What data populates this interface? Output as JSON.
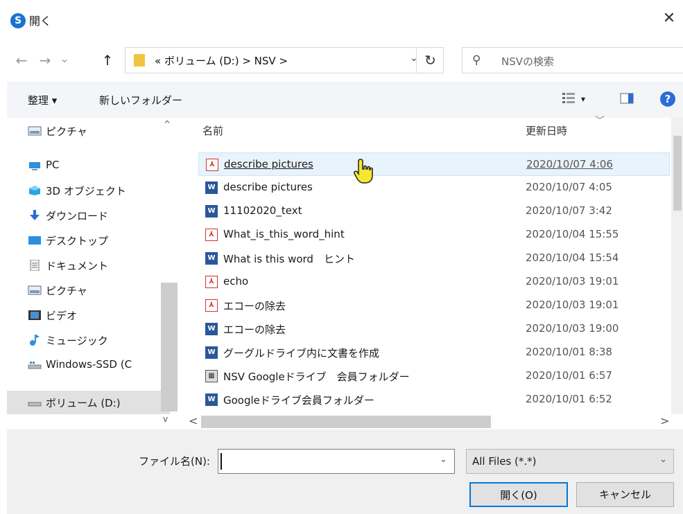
{
  "window": {
    "app_icon": "S",
    "title": "開く",
    "close_glyph": "✕"
  },
  "nav": {
    "back": "←",
    "forward": "→",
    "recent": "⌄",
    "up": "↑",
    "address": "«  ボリューム (D:)  >  NSV  >",
    "address_drop": "⌄",
    "refresh": "↻",
    "search_icon": "⚲",
    "search_placeholder": "NSVの検索"
  },
  "toolbar": {
    "organize": "整理 ▾",
    "new_folder": "新しいフォルダー",
    "view_drop": "▾",
    "help": "?"
  },
  "sidebar": {
    "items": [
      {
        "label": "ピクチャ",
        "icon": "pictures-icon"
      },
      {
        "label": "PC",
        "icon": "pc-icon"
      },
      {
        "label": "3D オブジェクト",
        "icon": "3d-objects-icon"
      },
      {
        "label": "ダウンロード",
        "icon": "downloads-icon"
      },
      {
        "label": "デスクトップ",
        "icon": "desktop-icon"
      },
      {
        "label": "ドキュメント",
        "icon": "documents-icon"
      },
      {
        "label": "ピクチャ",
        "icon": "pictures-icon"
      },
      {
        "label": "ビデオ",
        "icon": "videos-icon"
      },
      {
        "label": "ミュージック",
        "icon": "music-icon"
      },
      {
        "label": "Windows-SSD (C",
        "icon": "drive-icon"
      },
      {
        "label": "ボリューム (D:)",
        "icon": "drive-icon"
      }
    ]
  },
  "list": {
    "col_name": "名前",
    "col_date": "更新日時",
    "files": [
      {
        "name": "describe pictures",
        "date": "2020/10/07 4:06",
        "type": "pdf"
      },
      {
        "name": "describe pictures",
        "date": "2020/10/07 4:05",
        "type": "doc"
      },
      {
        "name": "11102020_text",
        "date": "2020/10/07 3:42",
        "type": "doc"
      },
      {
        "name": "What_is_this_word_hint",
        "date": "2020/10/04 15:55",
        "type": "pdf"
      },
      {
        "name": "What is this word　ヒント",
        "date": "2020/10/04 15:54",
        "type": "doc"
      },
      {
        "name": "echo",
        "date": "2020/10/03 19:01",
        "type": "pdf"
      },
      {
        "name": "エコーの除去",
        "date": "2020/10/03 19:01",
        "type": "pdf"
      },
      {
        "name": "エコーの除去",
        "date": "2020/10/03 19:00",
        "type": "doc"
      },
      {
        "name": "グーグルドライブ内に文書を作成",
        "date": "2020/10/01 8:38",
        "type": "doc"
      },
      {
        "name": "NSV Googleドライブ　会員フォルダー",
        "date": "2020/10/01 6:57",
        "type": "img"
      },
      {
        "name": "Googleドライブ会員フォルダー",
        "date": "2020/10/01 6:52",
        "type": "doc"
      }
    ]
  },
  "bottom": {
    "filename_label": "ファイル名(N):",
    "filename_value": "",
    "filter_value": "All Files (*.*)",
    "open_button": "開く(O)",
    "cancel_button": "キャンセル"
  },
  "colors": {
    "accent": "#0078d7",
    "pdf": "#d0312d",
    "doc": "#2b579a",
    "hover_row": "#e8f3fc"
  }
}
